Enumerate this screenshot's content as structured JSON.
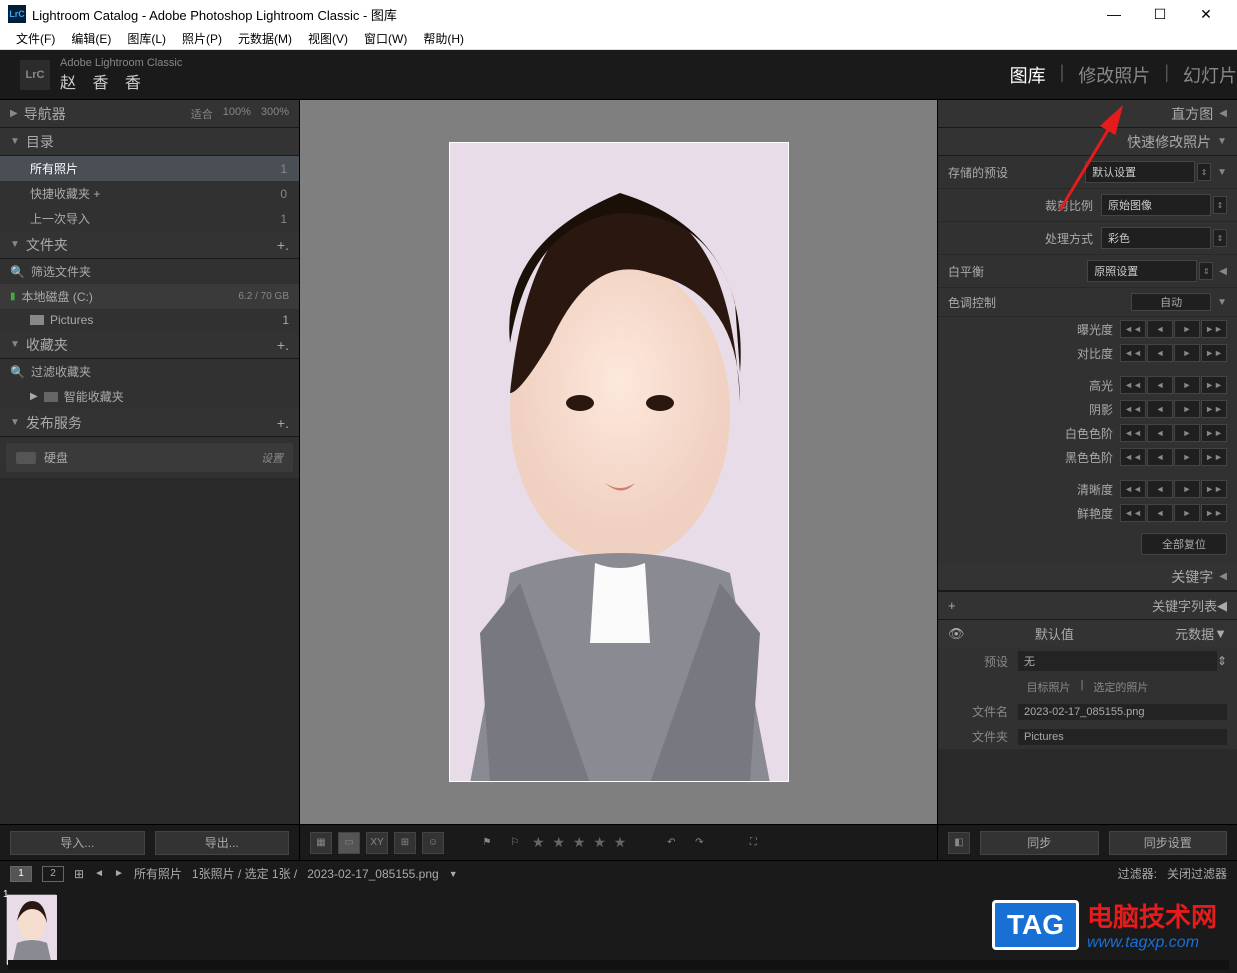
{
  "titlebar": {
    "title": "Lightroom Catalog - Adobe Photoshop Lightroom Classic - 图库"
  },
  "menu": {
    "items": [
      "文件(F)",
      "编辑(E)",
      "图库(L)",
      "照片(P)",
      "元数据(M)",
      "视图(V)",
      "窗口(W)",
      "帮助(H)"
    ]
  },
  "brand": {
    "top": "Adobe Lightroom Classic",
    "name": "赵 香 香"
  },
  "modules": {
    "items": [
      "图库",
      "修改照片",
      "幻灯片"
    ],
    "active": 0
  },
  "navigator": {
    "title": "导航器",
    "zoom": [
      "适合",
      "100%",
      "300%"
    ]
  },
  "catalog": {
    "title": "目录",
    "items": [
      {
        "label": "所有照片",
        "count": "1",
        "selected": true
      },
      {
        "label": "快捷收藏夹 +",
        "count": "0"
      },
      {
        "label": "上一次导入",
        "count": "1"
      }
    ]
  },
  "folders": {
    "title": "文件夹",
    "filter": "筛选文件夹",
    "drive": "本地磁盘 (C:)",
    "drive_usage": "6.2 / 70 GB",
    "items": [
      {
        "label": "Pictures",
        "count": "1"
      }
    ]
  },
  "collections": {
    "title": "收藏夹",
    "filter": "过滤收藏夹",
    "items": [
      {
        "label": "智能收藏夹"
      }
    ]
  },
  "publish": {
    "title": "发布服务",
    "items": [
      {
        "label": "硬盘",
        "setup": "设置"
      }
    ]
  },
  "buttons": {
    "import": "导入...",
    "export": "导出...",
    "sync": "同步",
    "sync_settings": "同步设置"
  },
  "histogram": {
    "title": "直方图"
  },
  "quick_dev": {
    "title": "快速修改照片",
    "preset_label": "存储的预设",
    "preset_value": "默认设置",
    "crop_label": "裁剪比例",
    "crop_value": "原始图像",
    "treatment_label": "处理方式",
    "treatment_value": "彩色",
    "wb_label": "白平衡",
    "wb_value": "原照设置",
    "tone_label": "色调控制",
    "auto": "自动",
    "sliders": [
      "曝光度",
      "对比度",
      "高光",
      "阴影",
      "白色色阶",
      "黑色色阶",
      "清晰度",
      "鲜艳度"
    ],
    "reset": "全部复位"
  },
  "keywording": {
    "title": "关键字"
  },
  "keyword_list": {
    "title": "关键字列表"
  },
  "metadata": {
    "title": "元数据",
    "default": "默认值",
    "preset_label": "预设",
    "preset_value": "无",
    "tabs": [
      "目标照片",
      "选定的照片"
    ],
    "filename_label": "文件名",
    "filename_value": "2023-02-17_085155.png",
    "folder_label": "文件夹",
    "folder_value": "Pictures"
  },
  "info_bar": {
    "all_photos": "所有照片",
    "counts": "1张照片 / 选定 1张 /",
    "filename": "2023-02-17_085155.png",
    "filter_label": "过滤器:",
    "filter_value": "关闭过滤器"
  },
  "watermark": {
    "tag": "TAG",
    "text": "电脑技术网",
    "url": "www.tagxp.com"
  }
}
